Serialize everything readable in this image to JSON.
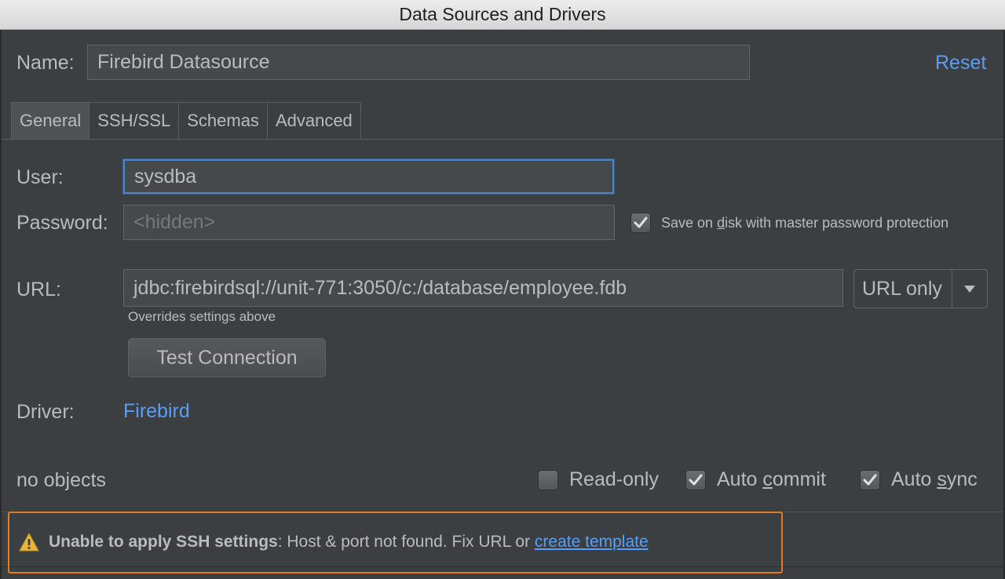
{
  "window": {
    "title": "Data Sources and Drivers"
  },
  "name": {
    "label": "Name:",
    "value": "Firebird Datasource",
    "reset_label": "Reset"
  },
  "tabs": [
    {
      "label": "General",
      "active": true
    },
    {
      "label": "SSH/SSL",
      "active": false
    },
    {
      "label": "Schemas",
      "active": false
    },
    {
      "label": "Advanced",
      "active": false
    }
  ],
  "user": {
    "label": "User:",
    "value": "sysdba"
  },
  "password": {
    "label": "Password:",
    "placeholder": "<hidden>",
    "save_checked": true,
    "save_label_pre": "Save on ",
    "save_label_underlined": "d",
    "save_label_post": "isk with master password protection"
  },
  "url": {
    "label": "URL:",
    "value": "jdbc:firebirdsql://unit-771:3050/c:/database/employee.fdb",
    "mode": "URL only",
    "hint": "Overrides settings above"
  },
  "test_connection_label": "Test Connection",
  "driver": {
    "label": "Driver:",
    "value": "Firebird"
  },
  "footer": {
    "status": "no objects",
    "read_only": {
      "label": "Read-only",
      "checked": false
    },
    "auto_commit": {
      "label_pre": "Auto ",
      "label_u": "c",
      "label_post": "ommit",
      "checked": true
    },
    "auto_sync": {
      "label_pre": "Auto ",
      "label_u": "s",
      "label_post": "ync",
      "checked": true
    }
  },
  "warning": {
    "icon": "warning-triangle-icon",
    "bold": "Unable to apply SSH settings",
    "text": ": Host & port not found. Fix URL or ",
    "link": "create template",
    "border_color": "#e37b20"
  },
  "colors": {
    "link": "#589df6",
    "background": "#3c3f41",
    "focus": "#4d84c6"
  }
}
